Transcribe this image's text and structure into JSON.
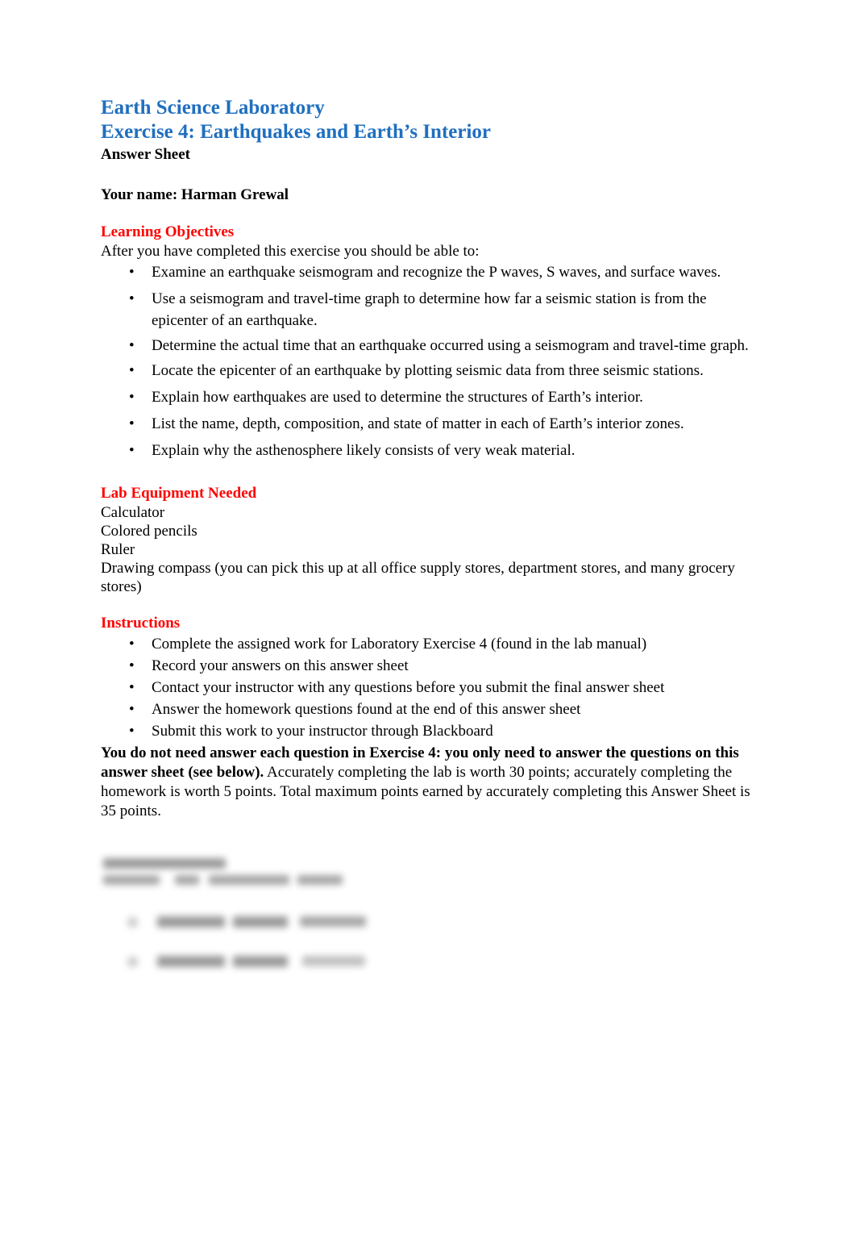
{
  "document": {
    "title_line_1": "Earth Science Laboratory",
    "title_line_2": "Exercise 4: Earthquakes and Earth’s Interior",
    "subtitle": "Answer Sheet",
    "name_line": "Your name: Harman Grewal",
    "colors": {
      "heading_blue": "#1F6FBF",
      "section_red": "#FF0000",
      "body_black": "#000000",
      "page_background": "#FFFFFF"
    }
  },
  "learning_objectives": {
    "heading": " Learning Objectives",
    "lead": "After you have completed this exercise you should be able to:",
    "items": [
      "Examine an earthquake seismogram and recognize the P waves, S waves, and surface waves.",
      "Use a seismogram and travel-time graph to determine how far a seismic station is from the epicenter of an earthquake.",
      "Determine the actual time that an earthquake occurred using a seismogram and travel-time graph.",
      "Locate the epicenter of an earthquake by plotting seismic data from three seismic stations.",
      "Explain how earthquakes are used to determine the structures of Earth’s interior.",
      "List the name, depth, composition, and state of matter in each of Earth’s interior zones.",
      "Explain why the asthenosphere likely consists of very weak material."
    ]
  },
  "lab_equipment": {
    "heading": "Lab Equipment Needed",
    "items": [
      "Calculator",
      "Colored pencils",
      "Ruler",
      "Drawing compass (you can pick this up at all office supply stores, department stores, and many grocery stores)"
    ]
  },
  "instructions": {
    "heading": "Instructions",
    "items": [
      "Complete the assigned work for Laboratory Exercise 4 (found in the lab manual)",
      "Record your answers on this answer sheet",
      "Contact your instructor with any questions before you submit the final answer sheet",
      "Answer the homework questions found at the end of this answer sheet",
      "Submit this work to your instructor through Blackboard"
    ],
    "note_bold": "You do not need answer each question in Exercise 4: you only need to answer the questions on this answer sheet (see below).",
    "note_regular": " Accurately completing the lab is worth 30 points; accurately completing the homework is worth 5 points. Total maximum points earned by accurately completing this Answer Sheet is 35 points."
  },
  "obscured_section": {
    "note": "blurred-illegible",
    "bullet_marker": "•"
  }
}
